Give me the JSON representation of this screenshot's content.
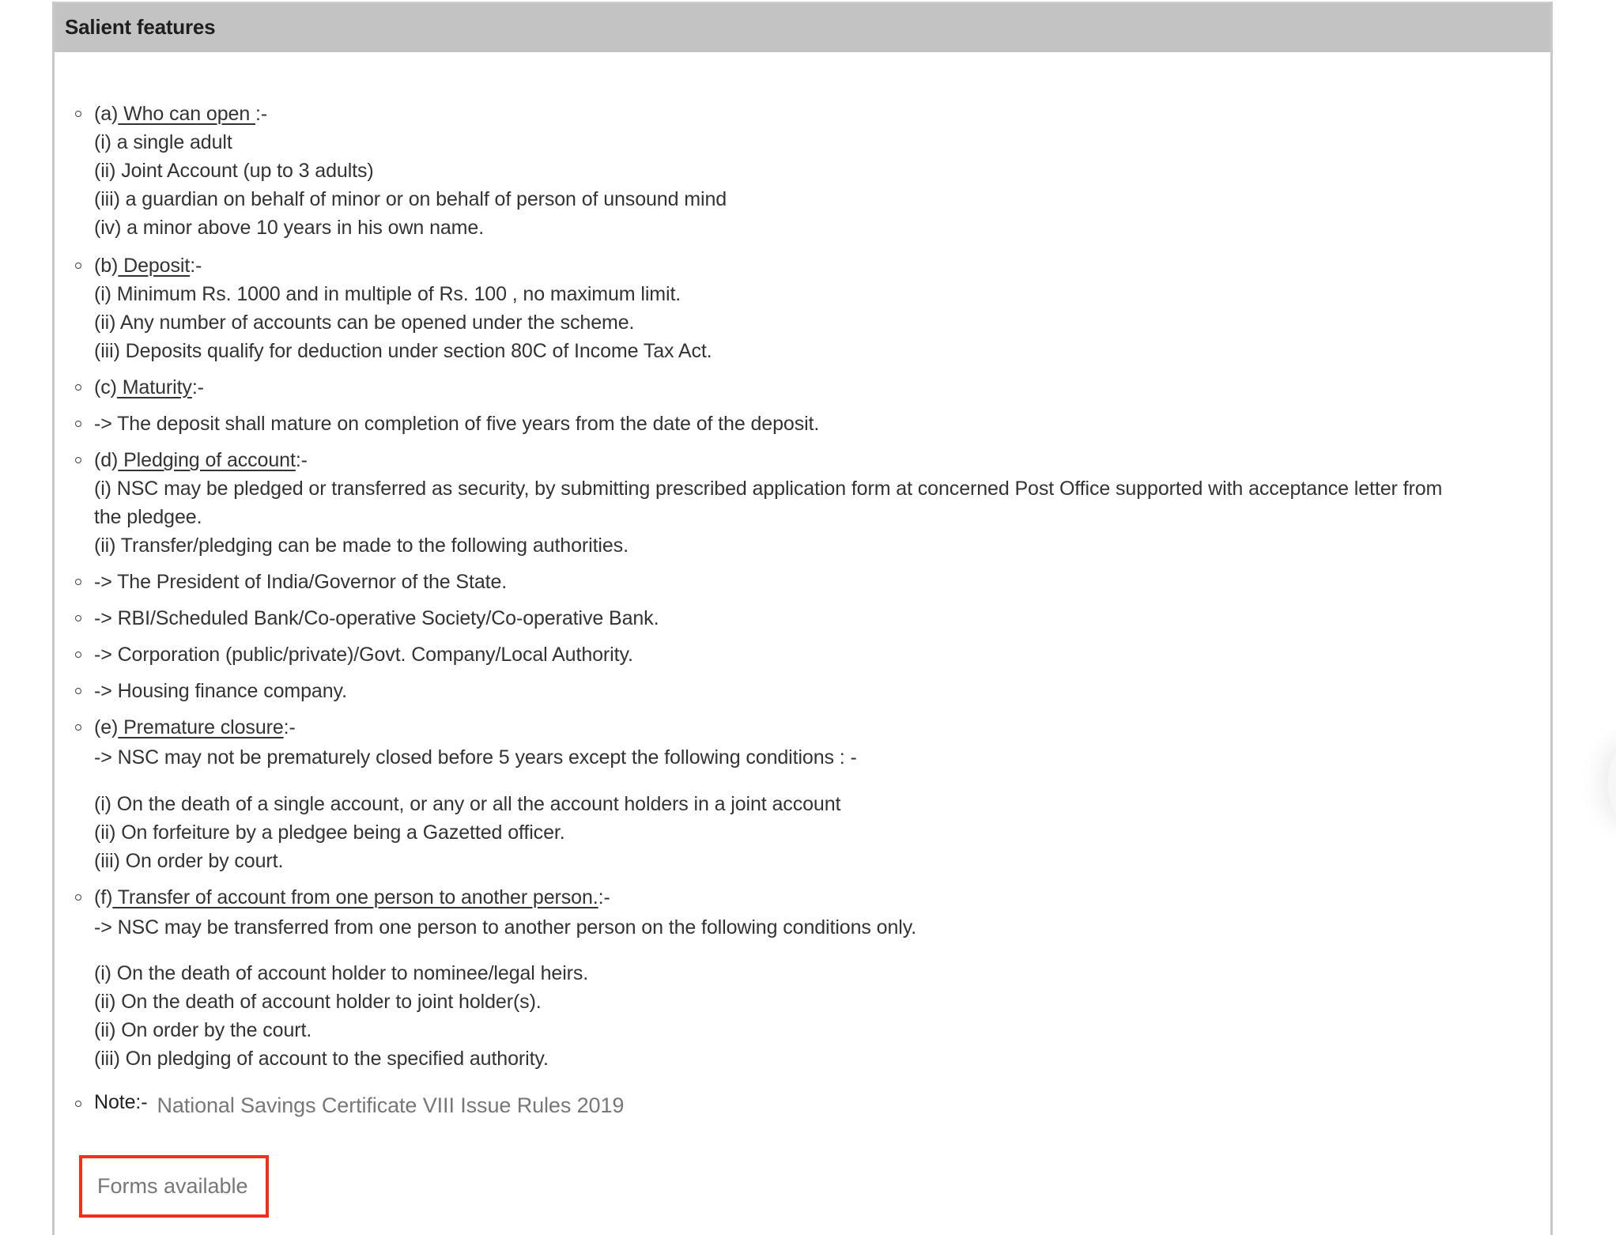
{
  "panel": {
    "title": "Salient features"
  },
  "sections": {
    "a": {
      "prefix": "(a)",
      "heading": " Who can open ",
      "suffix": ":-",
      "lines": [
        "(i) a single adult",
        "(ii) Joint Account (up to 3 adults)",
        "(iii) a guardian on behalf of minor or on behalf of person of unsound mind",
        "(iv) a minor above 10 years in his own name."
      ]
    },
    "b": {
      "prefix": "(b)",
      "heading": " Deposit",
      "suffix": ":-",
      "lines": [
        "(i) Minimum Rs. 1000 and in multiple of Rs. 100 , no maximum limit.",
        "(ii) Any number of accounts can be opened under the scheme.",
        "(iii) Deposits qualify for deduction under section 80C of Income Tax Act."
      ]
    },
    "c": {
      "prefix": "(c)",
      "heading": " Maturity",
      "suffix": ":-",
      "bullet_text": "-> The deposit shall mature on completion of five years from the date of the deposit."
    },
    "d": {
      "prefix": "(d)",
      "heading": " Pledging of account",
      "suffix": ":-",
      "lines": [
        "(i) NSC may be pledged or transferred as security, by submitting prescribed application form at concerned Post Office supported with acceptance letter from",
        "the pledgee.",
        "(ii) Transfer/pledging can be made to the following authorities."
      ],
      "authorities": [
        "-> The President of India/Governor of the State.",
        "-> RBI/Scheduled Bank/Co-operative Society/Co-operative Bank.",
        "-> Corporation (public/private)/Govt. Company/Local Authority.",
        "-> Housing finance company."
      ]
    },
    "e": {
      "prefix": "(e)",
      "heading": " Premature closure",
      "suffix": ":-",
      "intro": "-> NSC may not be prematurely closed before 5 years except the following conditions : -",
      "lines": [
        "(i) On the death of a single account, or any or all the account holders in a joint account",
        "(ii) On forfeiture by a pledgee being a Gazetted officer.",
        "(iii) On order by court."
      ]
    },
    "f": {
      "prefix": "(f)",
      "heading": " Transfer of account from one person to another person.",
      "suffix": ":-",
      "intro": "-> NSC may be transferred from one person to another person on the following conditions only.",
      "lines": [
        "(i) On the death of account holder to nominee/legal heirs.",
        "(ii) On the death of account holder to joint holder(s).",
        "(ii) On order by the court.",
        "(iii) On pledging of account to the specified authority."
      ]
    }
  },
  "note": {
    "label": "Note:-",
    "link_text": "National Savings Certificate VIII Issue Rules 2019"
  },
  "forms": {
    "label": "Forms available",
    "highlight_color": "#f0301a"
  }
}
